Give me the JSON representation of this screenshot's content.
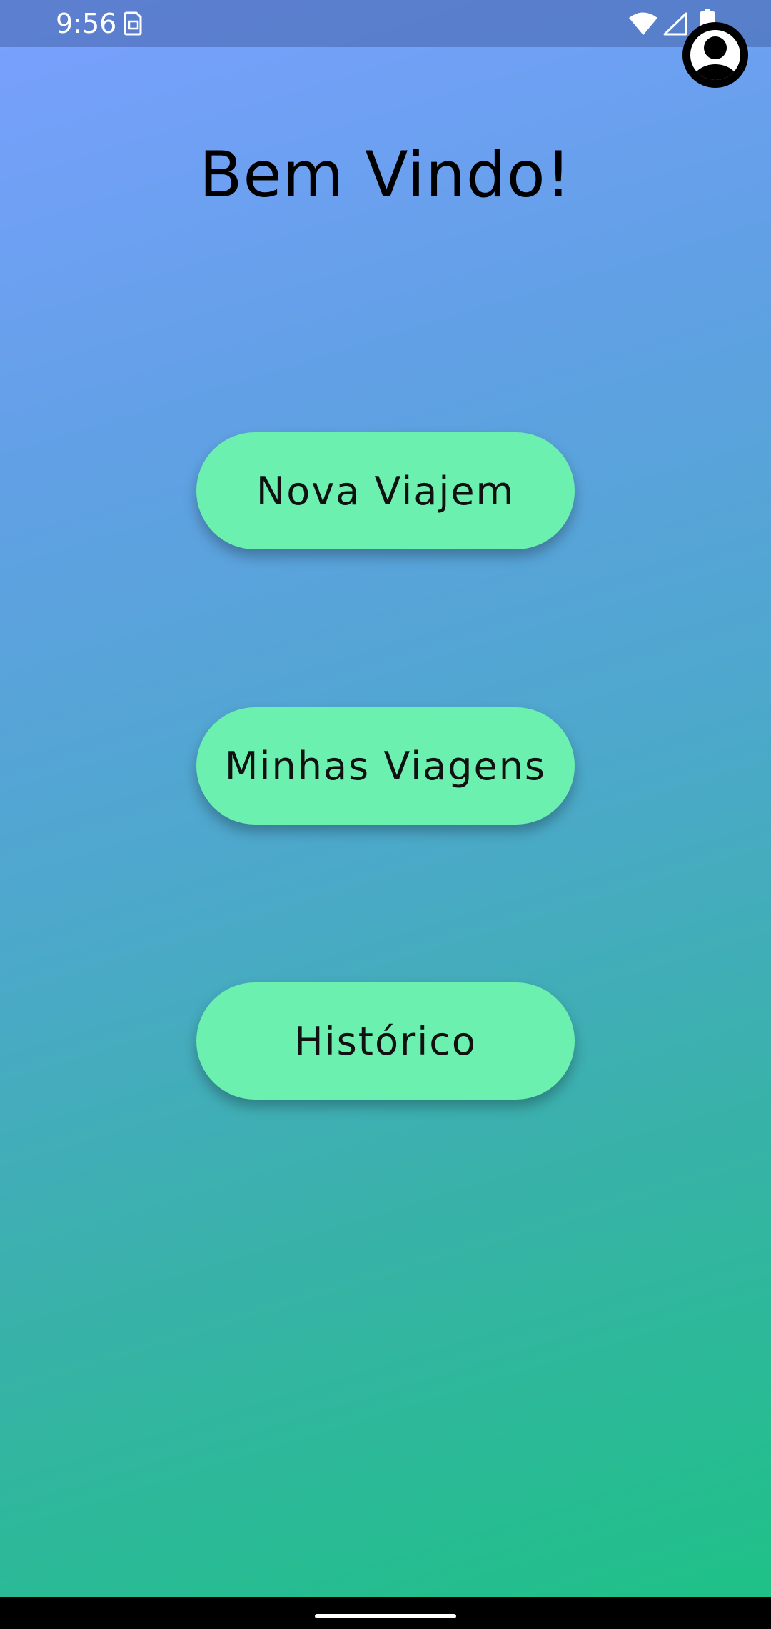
{
  "status_bar": {
    "time": "9:56",
    "notification_icon": "sim-card-icon",
    "wifi_icon": "wifi-icon",
    "signal_icon": "signal-icon",
    "battery_icon": "battery-icon"
  },
  "header": {
    "profile_icon": "account-circle-icon",
    "title": "Bem Vindo!"
  },
  "menu": {
    "buttons": [
      {
        "label": "Nova Viajem"
      },
      {
        "label": "Minhas Viagens"
      },
      {
        "label": "Histórico"
      }
    ]
  },
  "colors": {
    "button_background": "#6cf0b0",
    "gradient_top": "#7aa0ff",
    "gradient_bottom": "#1dc285"
  }
}
